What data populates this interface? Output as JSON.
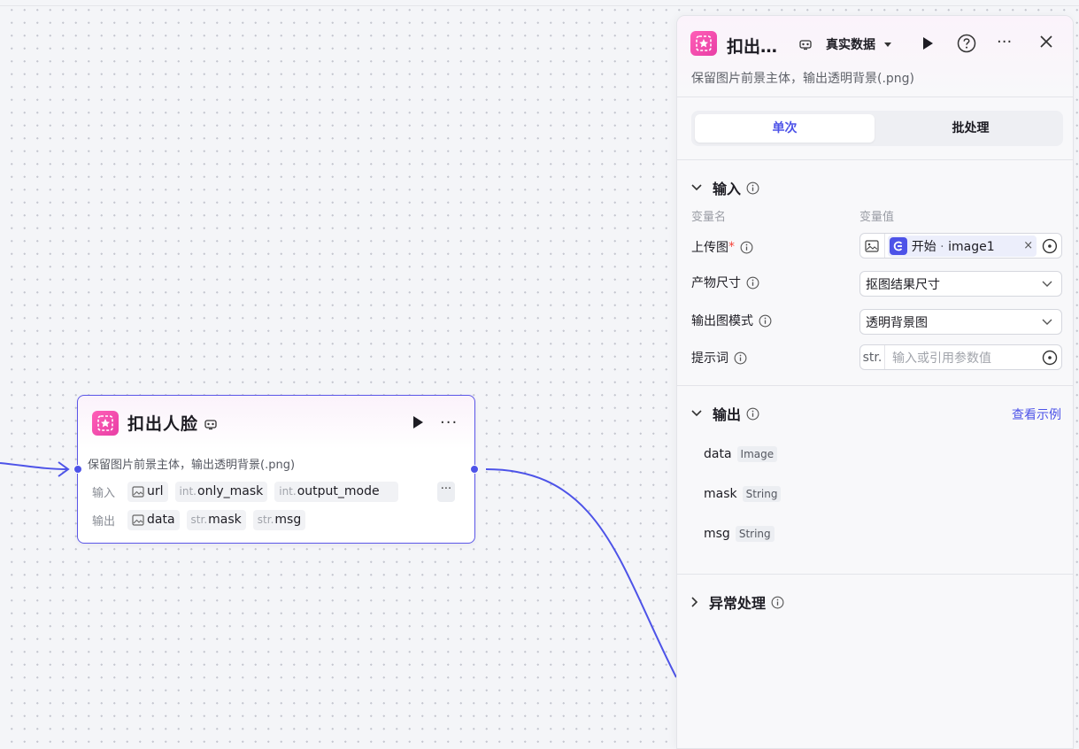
{
  "node": {
    "title": "扣出人脸",
    "description": "保留图片前景主体，输出透明背景(.png)",
    "input_label": "输入",
    "output_label": "输出",
    "inputs": [
      {
        "prefix": "",
        "name": "url",
        "icon": "image-icon"
      },
      {
        "prefix": "int.",
        "name": "only_mask"
      },
      {
        "prefix": "int.",
        "name": "output_mode"
      }
    ],
    "outputs": [
      {
        "prefix": "",
        "name": "data",
        "icon": "image-icon"
      },
      {
        "prefix": "str.",
        "name": "mask"
      },
      {
        "prefix": "str.",
        "name": "msg"
      }
    ],
    "more_symbol": "···"
  },
  "panel": {
    "title": "扣出…",
    "data_mode": "真实数据",
    "description": "保留图片前景主体，输出透明背景(.png)",
    "tabs": [
      "单次",
      "批处理"
    ],
    "input_section": {
      "title": "输入",
      "col_name": "变量名",
      "col_value": "变量值",
      "fields": [
        {
          "label": "上传图",
          "required_mark": "*",
          "ref_node": "开始",
          "ref_sep": " · ",
          "ref_var": "image1",
          "clear": "×"
        },
        {
          "label": "产物尺寸",
          "value": "抠图结果尺寸"
        },
        {
          "label": "输出图模式",
          "value": "透明背景图"
        },
        {
          "label": "提示词",
          "type_prefix": "str.",
          "placeholder": "输入或引用参数值"
        }
      ]
    },
    "output_section": {
      "title": "输出",
      "view_example": "查看示例",
      "items": [
        {
          "name": "data",
          "type": "Image"
        },
        {
          "name": "mask",
          "type": "String"
        },
        {
          "name": "msg",
          "type": "String"
        }
      ]
    },
    "exception_section": {
      "title": "异常处理"
    }
  },
  "colors": {
    "accent": "#4d53e8",
    "node_icon": "#e83ea5",
    "required": "#f5433a"
  }
}
